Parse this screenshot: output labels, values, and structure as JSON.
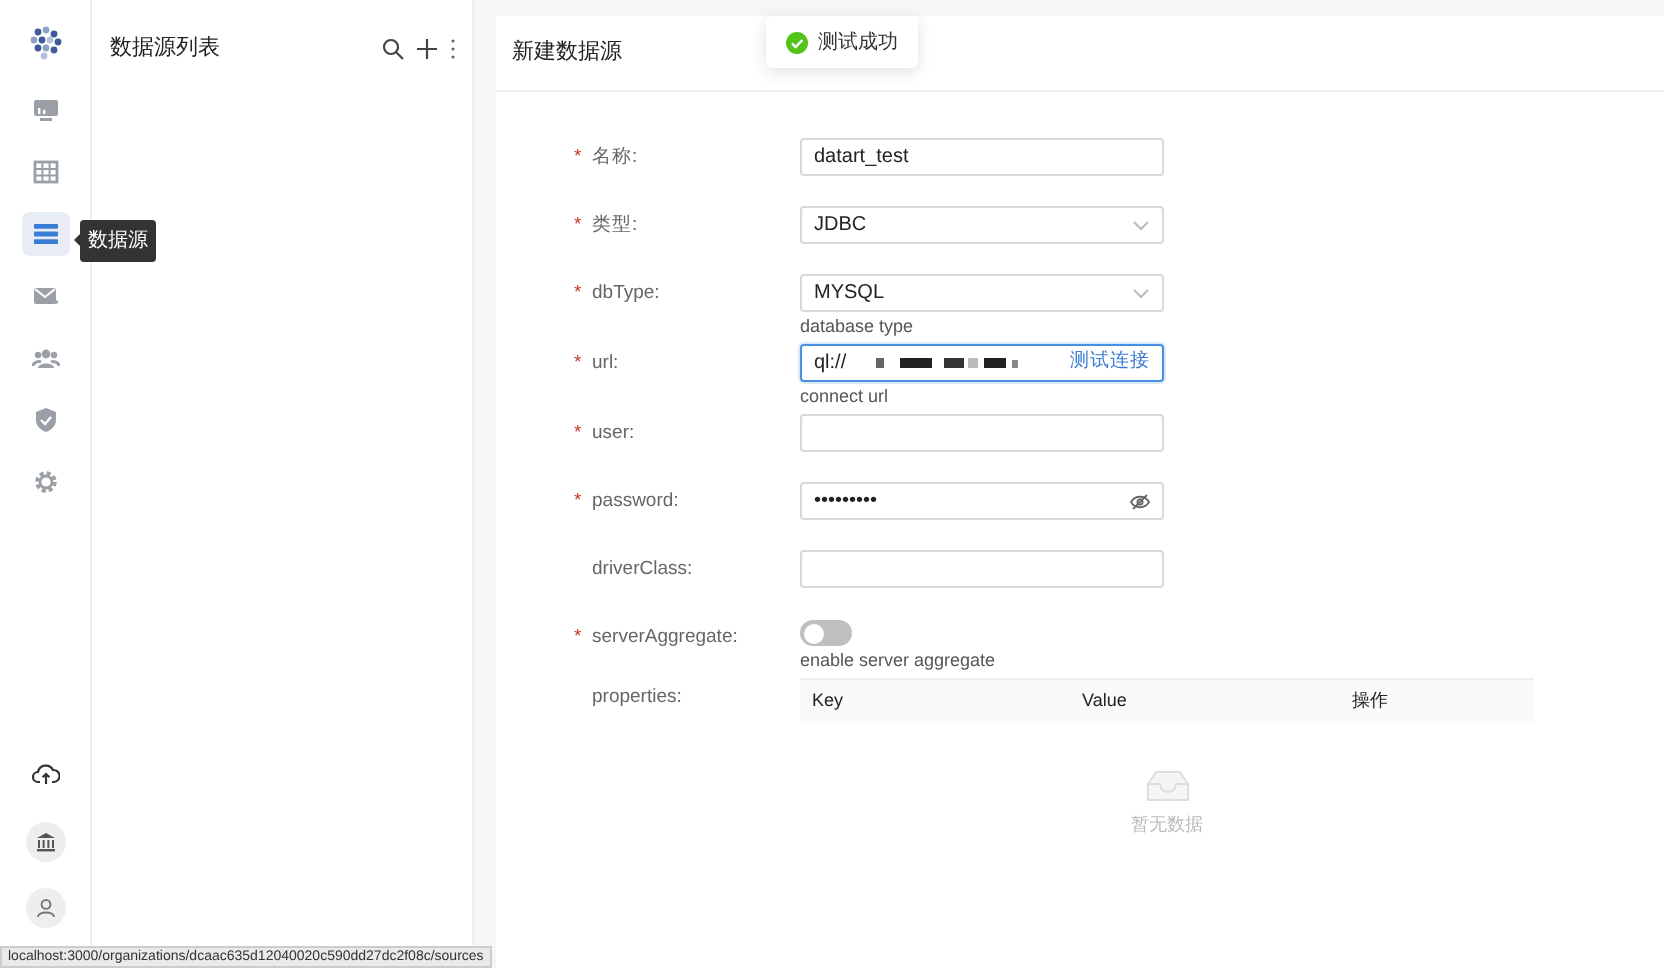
{
  "nav": {
    "items": [
      {
        "selected": false
      },
      {
        "selected": false
      },
      {
        "selected": true
      },
      {
        "selected": false
      },
      {
        "selected": false
      },
      {
        "selected": false
      },
      {
        "selected": false
      }
    ],
    "tooltip": "数据源"
  },
  "list_panel": {
    "title": "数据源列表"
  },
  "toast": {
    "text": "测试成功"
  },
  "form": {
    "title": "新建数据源",
    "fields": [
      {
        "kind": "text",
        "mark": "*",
        "label": "名称:",
        "value": "datart_test"
      },
      {
        "kind": "select",
        "mark": "*",
        "label": "类型:",
        "value": "JDBC"
      },
      {
        "kind": "select",
        "mark": "*",
        "label": "dbType:",
        "value": "MYSQL",
        "help": "database type"
      },
      {
        "kind": "url",
        "mark": "*",
        "label": "url:",
        "value": "ql://",
        "action": "测试连接",
        "help": "connect url",
        "focused": true
      },
      {
        "kind": "text",
        "mark": "*",
        "label": "user:"
      },
      {
        "kind": "password",
        "mark": "*",
        "label": "password:",
        "value": "•••••••••"
      },
      {
        "kind": "text",
        "label": "driverClass:"
      },
      {
        "kind": "switch",
        "mark": "*",
        "label": "serverAggregate:",
        "on": false,
        "help": "enable server aggregate"
      },
      {
        "kind": "table",
        "label": "properties:",
        "columns": [
          "Key",
          "Value",
          "操作"
        ],
        "empty_text": "暂无数据"
      }
    ]
  },
  "status_bar": {
    "url": "localhost:3000/organizations/dcaac635d12040020c590dd27dc2f08c/sources"
  }
}
